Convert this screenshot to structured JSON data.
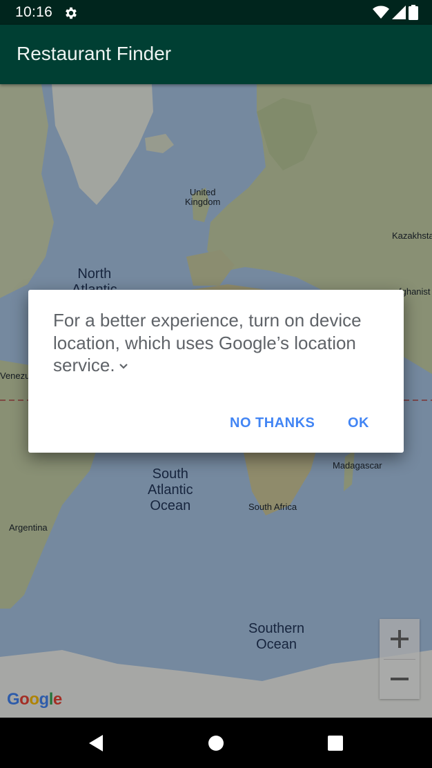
{
  "status_bar": {
    "time": "10:16",
    "icons": [
      "gear-icon",
      "wifi-icon",
      "signal-icon",
      "battery-icon"
    ]
  },
  "app_bar": {
    "title": "Restaurant Finder"
  },
  "map": {
    "labels": {
      "united_kingdom_1": "United",
      "united_kingdom_2": "Kingdom",
      "kazakhstan": "Kazakhsta",
      "afghanistan": "fghanist",
      "north_atlantic_1": "North",
      "north_atlantic_2": "Atlantic",
      "venezuela": "Venezue",
      "madagascar": "Madagascar",
      "south_atlantic_1": "South",
      "south_atlantic_2": "Atlantic",
      "south_atlantic_3": "Ocean",
      "south_africa": "South Africa",
      "argentina": "Argentina",
      "southern_ocean_1": "Southern",
      "southern_ocean_2": "Ocean"
    },
    "logo": {
      "G": "G",
      "o1": "o",
      "o2": "o",
      "g": "g",
      "l": "l",
      "e": "e"
    },
    "zoom_in_icon": "plus-icon",
    "zoom_out_icon": "minus-icon",
    "colors": {
      "water": "#a8c4e4",
      "land": "#cdd6b4",
      "equator": "#b04a4a"
    }
  },
  "dialog": {
    "message": "For a better experience, turn on device location, which uses Google’s location service.",
    "expand_icon": "chevron-down-icon",
    "negative_label": "NO THANKS",
    "positive_label": "OK",
    "accent_color": "#4285f4"
  },
  "nav_bar": {
    "icons": [
      "back-icon",
      "home-icon",
      "recents-icon"
    ]
  }
}
